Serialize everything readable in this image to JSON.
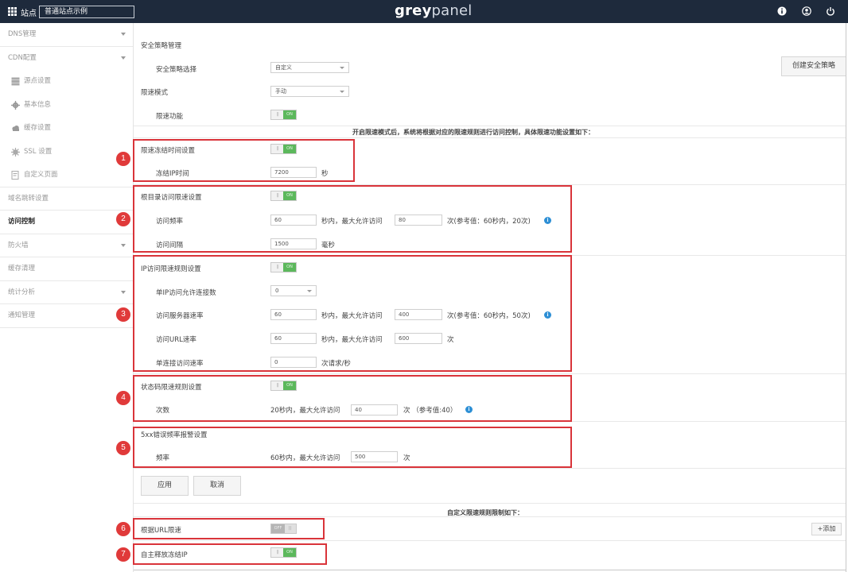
{
  "topbar": {
    "site_label": "站点",
    "site_select_value": "普通站点示例",
    "logo_part1": "grey",
    "logo_part2": "panel",
    "icons": [
      "info-icon",
      "user-icon",
      "power-icon"
    ]
  },
  "sidebar": {
    "items": [
      {
        "label": "DNS管理"
      },
      {
        "label": "CDN配置"
      },
      {
        "label": "源点设置",
        "icon": "server-icon"
      },
      {
        "label": "基本信息",
        "icon": "gear-icon"
      },
      {
        "label": "缓存设置",
        "icon": "cloud-icon"
      },
      {
        "label": "SSL 设置",
        "icon": "ssl-gear-icon"
      },
      {
        "label": "自定义页面",
        "icon": "page-icon"
      },
      {
        "label": "域名跳转设置"
      },
      {
        "label": "访问控制"
      },
      {
        "label": "防火墙"
      },
      {
        "label": "缓存清理"
      },
      {
        "label": "统计分析"
      },
      {
        "label": "通知管理"
      }
    ]
  },
  "main": {
    "section_title": "安全策略管理",
    "policy_select_label": "安全策略选择",
    "policy_select_value": "自定义",
    "create_button": "创建安全策略",
    "rate_mode_label": "限速模式",
    "rate_mode_value": "手动",
    "rate_func_label": "限速功能",
    "notice": "开启限速模式后，系统将根据对应的限速规则进行访问控制，具体限速功能设置如下：",
    "toggle_off": "||",
    "toggle_on": "ON",
    "toggle_off_text": "OFF",
    "freeze": {
      "title": "限速冻结时间设置",
      "ip_label": "冻结IP时间",
      "ip_value": "7200",
      "unit": "秒"
    },
    "root": {
      "title": "根目录访问限速设置",
      "freq_label": "访问频率",
      "freq_value": "60",
      "mid": "秒内，最大允许访问",
      "max_value": "80",
      "ref": "次(参考值：60秒内，20次)",
      "interval_label": "访问间隔",
      "interval_value": "1500",
      "interval_unit": "毫秒"
    },
    "ip_rules": {
      "title": "IP访问限速规则设置",
      "conn_label": "单IP访问允许连接数",
      "conn_value": "0",
      "server_label": "访问服务器速率",
      "server_value": "60",
      "mid": "秒内，最大允许访问",
      "server_max": "400",
      "server_ref": "次(参考值：60秒内，50次)",
      "url_label": "访问URL速率",
      "url_value": "60",
      "url_max": "600",
      "url_unit": "次",
      "single_label": "单连接访问速率",
      "single_value": "0",
      "single_unit": "次请求/秒"
    },
    "status_code": {
      "title": "状态码限速规则设置",
      "count_label": "次数",
      "count_prefix": "20秒内，最大允许访问",
      "count_value": "40",
      "count_suffix": "次 （参考值:40）"
    },
    "alarm": {
      "title": "5xx错误频率报警设置",
      "freq_label": "频率",
      "freq_prefix": "60秒内，最大允许访问",
      "freq_value": "500",
      "freq_suffix": "次"
    },
    "apply_button": "应用",
    "cancel_button": "取消",
    "custom_notice": "自定义限速规则限制如下：",
    "url_rate_label": "根据URL限速",
    "add_button": "+添加",
    "auto_release_label": "自主释放冻结IP"
  },
  "badges": [
    "1",
    "2",
    "3",
    "4",
    "5",
    "6",
    "7"
  ],
  "colors": {
    "topbar": "#1e2a3c",
    "highlight_red": "#d9343a",
    "badge_red": "#e03a3a",
    "toggle_on": "#5cb85c",
    "info_blue": "#2d8fd5"
  }
}
